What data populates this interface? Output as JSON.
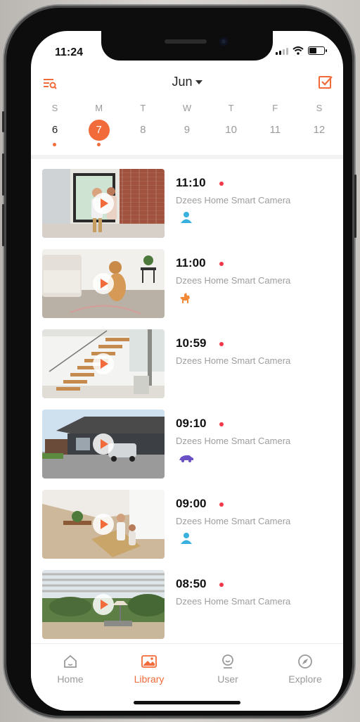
{
  "status_bar": {
    "time": "11:24"
  },
  "header": {
    "month": "Jun"
  },
  "colors": {
    "accent": "#f26b3a",
    "alert_dot": "#f0384a",
    "person_icon": "#3ab0e0",
    "dog_icon": "#f28a3a",
    "car_icon": "#6b4fc4"
  },
  "week": [
    {
      "dow": "S",
      "date": "6",
      "today": true,
      "has_events": true
    },
    {
      "dow": "M",
      "date": "7",
      "selected": true,
      "has_events": true
    },
    {
      "dow": "T",
      "date": "8"
    },
    {
      "dow": "W",
      "date": "9"
    },
    {
      "dow": "T",
      "date": "10"
    },
    {
      "dow": "F",
      "date": "11"
    },
    {
      "dow": "S",
      "date": "12"
    }
  ],
  "events": [
    {
      "time": "11:10",
      "camera": "Dzees Home Smart Camera",
      "icon": "person-icon",
      "scene": "doorway with child and woman"
    },
    {
      "time": "11:00",
      "camera": "Dzees Home Smart Camera",
      "icon": "dog-icon",
      "scene": "dog sitting in living room"
    },
    {
      "time": "10:59",
      "camera": "Dzees Home Smart Camera",
      "icon": "",
      "scene": "staircase interior"
    },
    {
      "time": "09:10",
      "camera": "Dzees Home Smart Camera",
      "icon": "car-icon",
      "scene": "car in driveway"
    },
    {
      "time": "09:00",
      "camera": "Dzees Home Smart Camera",
      "icon": "person-icon",
      "scene": "people in living room"
    },
    {
      "time": "08:50",
      "camera": "Dzees Home Smart Camera",
      "icon": "",
      "scene": "patio with pergola"
    }
  ],
  "tabs": [
    {
      "label": "Home",
      "icon": "home-icon"
    },
    {
      "label": "Library",
      "icon": "library-icon",
      "active": true
    },
    {
      "label": "User",
      "icon": "user-icon"
    },
    {
      "label": "Explore",
      "icon": "compass-icon"
    }
  ]
}
